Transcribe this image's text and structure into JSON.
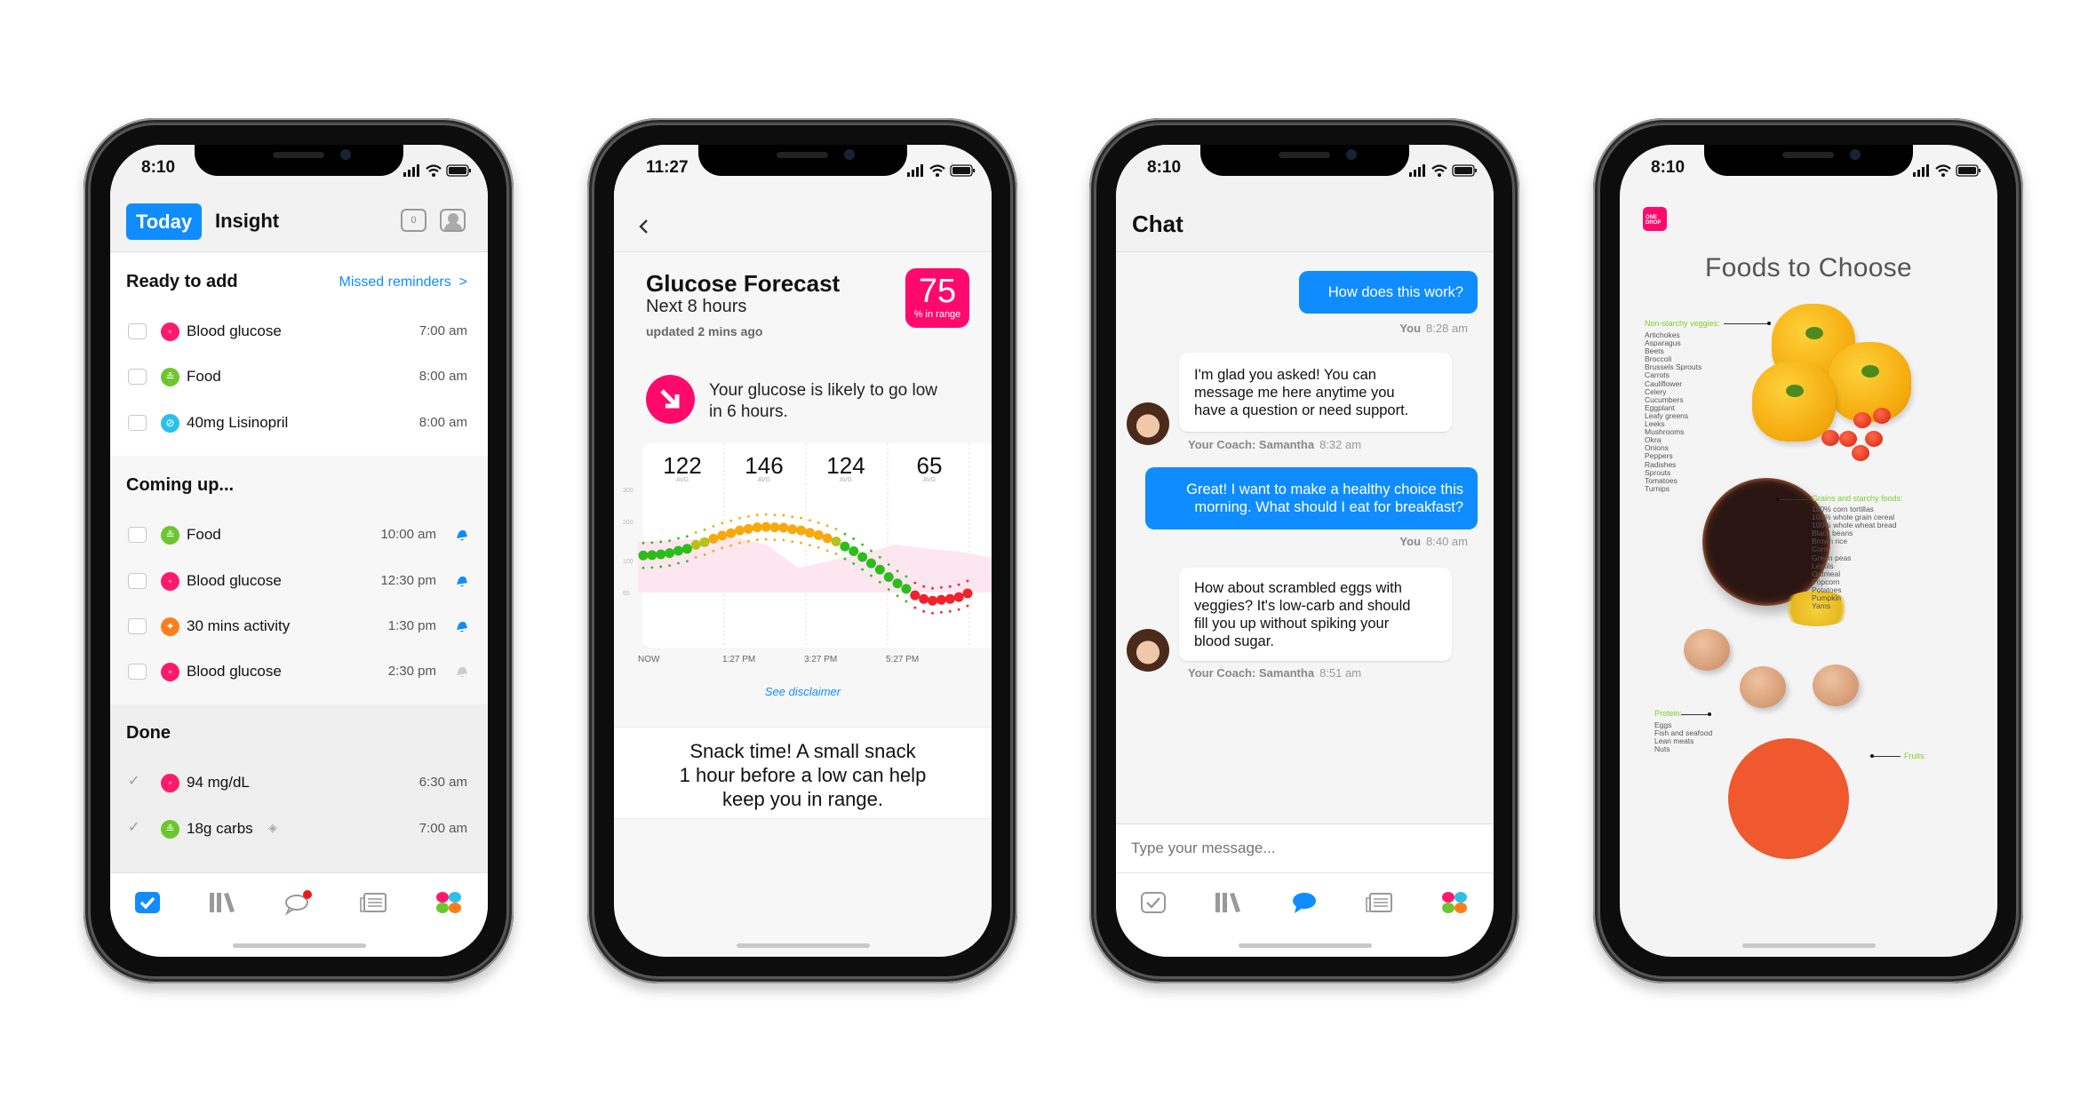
{
  "colors": {
    "accent": "#0f8cff",
    "brand": "#ff0a6c",
    "glucose": "#ff1a6e",
    "food": "#6cc72e",
    "med": "#2bc0e8",
    "activity": "#ff7d1a"
  },
  "phone1": {
    "status_time": "8:10",
    "tabs": {
      "today": "Today",
      "insight": "Insight"
    },
    "messages_badge": "0",
    "ready": {
      "title": "Ready to add",
      "link": "Missed reminders",
      "link_chevron": ">",
      "items": [
        {
          "label": "Blood glucose",
          "time": "7:00 am",
          "icon": "drop-icon"
        },
        {
          "label": "Food",
          "time": "8:00 am",
          "icon": "food-icon"
        },
        {
          "label": "40mg Lisinopril",
          "time": "8:00 am",
          "icon": "pill-icon"
        }
      ]
    },
    "coming": {
      "title": "Coming up...",
      "items": [
        {
          "label": "Food",
          "time": "10:00 am",
          "icon": "food-icon",
          "bell": "active"
        },
        {
          "label": "Blood glucose",
          "time": "12:30 pm",
          "icon": "drop-icon",
          "bell": "active"
        },
        {
          "label": "30 mins activity",
          "time": "1:30 pm",
          "icon": "run-icon",
          "bell": "active"
        },
        {
          "label": "Blood glucose",
          "time": "2:30 pm",
          "icon": "drop-icon",
          "bell": "muted"
        }
      ]
    },
    "done": {
      "title": "Done",
      "items": [
        {
          "label": "94 mg/dL",
          "time": "6:30 am",
          "icon": "drop-icon"
        },
        {
          "label": "18g carbs",
          "time": "7:00 am",
          "icon": "food-icon"
        }
      ]
    },
    "tabbar": [
      "checklist-icon",
      "library-icon",
      "chat-icon",
      "news-icon",
      "apps-icon"
    ]
  },
  "phone2": {
    "status_time": "11:27",
    "title": "Glucose Forecast",
    "subtitle": "Next 8 hours",
    "updated": "updated 2 mins ago",
    "badge": {
      "value": "75",
      "label": "% in range"
    },
    "alert": {
      "line1": "Your glucose is likely to go low",
      "line2": "in 6 hours."
    },
    "disclaimer": "See disclaimer",
    "snack": {
      "line1": "Snack time! A small snack",
      "line2": "1 hour before a low can help",
      "line3": "keep you in range."
    }
  },
  "chart_data": {
    "type": "scatter",
    "title": "",
    "averages": [
      {
        "value": "122",
        "label": "AVG"
      },
      {
        "value": "146",
        "label": "AVG"
      },
      {
        "value": "124",
        "label": "AVG"
      },
      {
        "value": "65",
        "label": "AVG"
      }
    ],
    "x_ticks": [
      "NOW",
      "1:27 PM",
      "3:27 PM",
      "5:27 PM"
    ],
    "y_ticks": [
      300,
      200,
      100,
      65
    ],
    "forecast": [
      113,
      114,
      116,
      119,
      125,
      130,
      140,
      147,
      156,
      164,
      170,
      177,
      181,
      185,
      186,
      185,
      184,
      180,
      177,
      171,
      165,
      157,
      149,
      136,
      124,
      109,
      97,
      90,
      82,
      75,
      69,
      62,
      58,
      56,
      57,
      58,
      60,
      64
    ],
    "range_band_upper": [
      149,
      152,
      156,
      160,
      140,
      92,
      100,
      118,
      141,
      130,
      123,
      108
    ],
    "range_band_lower": 65,
    "color_rule": {
      "low": "#f0222a",
      "in_range": "#2bbd1a",
      "elevated": "#b4c21a",
      "high": "#f6a90c"
    },
    "grid": "vertical dotted"
  },
  "phone3": {
    "status_time": "8:10",
    "title": "Chat",
    "messages": [
      {
        "from": "you",
        "lines": [
          "How does this work?"
        ],
        "sender": "You",
        "time": "8:28 am"
      },
      {
        "from": "coach",
        "lines": [
          "I'm glad you asked! You can",
          "message me here anytime you",
          "have a question or need support."
        ],
        "sender": "Your Coach: Samantha",
        "time": "8:32 am"
      },
      {
        "from": "you",
        "lines": [
          "Great! I want to make a healthy choice this",
          "morning. What should I eat for breakfast?"
        ],
        "sender": "You",
        "time": "8:40 am"
      },
      {
        "from": "coach",
        "lines": [
          "How about scrambled eggs with",
          "veggies? It's low-carb and should",
          "fill you up without spiking your",
          "blood sugar."
        ],
        "sender": "Your Coach: Samantha",
        "time": "8:51 am"
      }
    ],
    "input_placeholder": "Type your message..."
  },
  "phone4": {
    "status_time": "8:10",
    "logo": "ONE DROP",
    "title": "Foods to Choose",
    "veggies": {
      "heading": "Non-starchy veggies:",
      "items": [
        "Artichokes",
        "Asparagus",
        "Beets",
        "Broccoli",
        "Brussels Sprouts",
        "Carrots",
        "Cauliflower",
        "Celery",
        "Cucumbers",
        "Eggplant",
        "Leafy greens",
        "Leeks",
        "Mushrooms",
        "Okra",
        "Onions",
        "Peppers",
        "Radishes",
        "Sprouts",
        "Tomatoes",
        "Turnips"
      ]
    },
    "grains": {
      "heading": "Grains and starchy foods:",
      "items": [
        "100% corn tortillas",
        "100% whole grain cereal",
        "100% whole wheat bread",
        "Black beans",
        "Brown rice",
        "Corn",
        "Green peas",
        "Lentils",
        "Oatmeal",
        "Popcorn",
        "Potatoes",
        "Pumpkin",
        "Yams"
      ]
    },
    "protein": {
      "heading": "Protein:",
      "items": [
        "Eggs",
        "Fish and seafood",
        "Lean meats",
        "Nuts"
      ]
    },
    "fruits": {
      "heading": "Fruits:"
    }
  }
}
